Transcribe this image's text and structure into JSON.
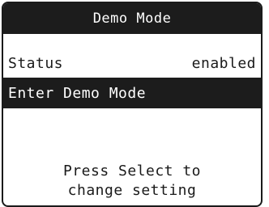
{
  "screen": {
    "title": "Demo Mode"
  },
  "menu": {
    "status_label": "Status",
    "status_value": "enabled",
    "enter_demo_label": "Enter Demo Mode"
  },
  "hint": {
    "line1": "Press Select to",
    "line2": "change setting"
  },
  "colors": {
    "background": "#ffffff",
    "foreground": "#1a1a1a",
    "highlight": "#1c1c1c",
    "highlight_text": "#ffffff"
  }
}
